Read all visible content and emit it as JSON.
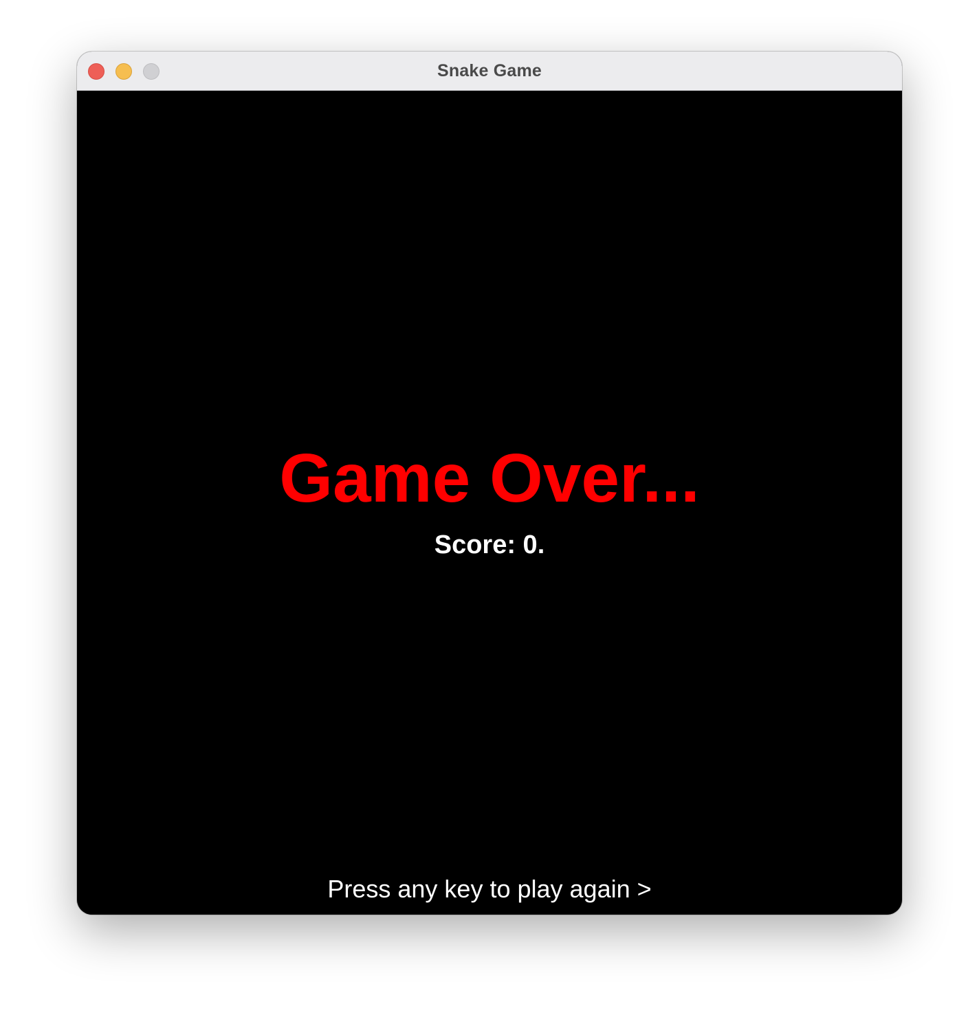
{
  "window": {
    "title": "Snake Game"
  },
  "game": {
    "title": "Game Over...",
    "score_text": "Score: 0.",
    "prompt": "Press any key to play again >"
  },
  "colors": {
    "background": "#000000",
    "title_text": "#ff0000",
    "body_text": "#ffffff",
    "titlebar": "#ececee",
    "close_button": "#ee5f57",
    "minimize_button": "#f6be50",
    "zoom_button": "#d0d0d3"
  }
}
